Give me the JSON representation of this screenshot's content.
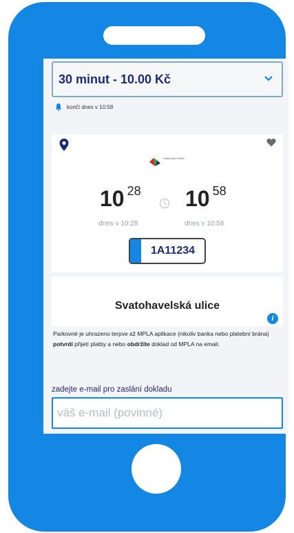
{
  "tariff": {
    "selected_label": "30 minut - 10.00 Kč"
  },
  "expiry": {
    "text": "končí dnes v 10:58"
  },
  "parking": {
    "logo_text": "Parkování v Brně",
    "start": {
      "hour": "10",
      "minute": "28",
      "date_label": "dnes v 10:28"
    },
    "end": {
      "hour": "10",
      "minute": "58",
      "date_label": "dnes v 10:58"
    },
    "plate": "1A11234"
  },
  "zone": {
    "street": "Svatohavelská ulice"
  },
  "notice": {
    "part1": "Parkovné je uhrazeno terpve až MPLA aplikace (nikoliv banka nebo platební brána) ",
    "bold1": "potvrdí",
    "part2": " přijetí platby a nebo ",
    "bold2": "obdržíte",
    "part3": " doklad od MPLA na email."
  },
  "email": {
    "label": "zadejte e-mail pro zaslání dokladu",
    "placeholder": "váš e-mail (povinné)",
    "value": ""
  },
  "colors": {
    "phone": "#1487e4",
    "primary_text": "#1e2a78",
    "accent": "#1487e4"
  }
}
